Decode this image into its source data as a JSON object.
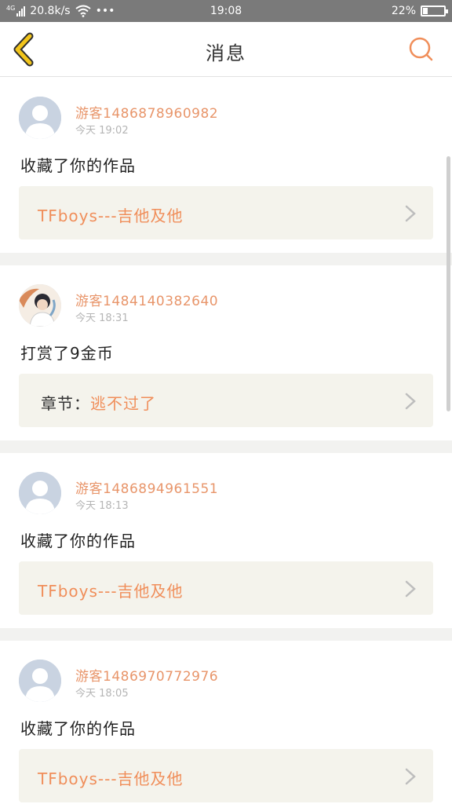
{
  "status_bar": {
    "network_type": "4G",
    "speed": "20.8k/s",
    "dots": "•••",
    "time": "19:08",
    "battery_percent": "22%",
    "battery_level": 0.22
  },
  "header": {
    "title": "消息",
    "back_icon": "chevron-left-icon",
    "search_icon": "search-icon"
  },
  "messages": [
    {
      "username": "游客1486878960982",
      "time": "今天 19:02",
      "action": "收藏了你的作品",
      "ref_label": "",
      "ref_title": "TFboys---吉他及他",
      "avatar": "default"
    },
    {
      "username": "游客1484140382640",
      "time": "今天 18:31",
      "action": "打赏了9金币",
      "ref_label": "章节：",
      "ref_title": "逃不过了",
      "avatar": "photo"
    },
    {
      "username": "游客1486894961551",
      "time": "今天 18:13",
      "action": "收藏了你的作品",
      "ref_label": "",
      "ref_title": "TFboys---吉他及他",
      "avatar": "default"
    },
    {
      "username": "游客1486970772976",
      "time": "今天 18:05",
      "action": "收藏了你的作品",
      "ref_label": "",
      "ref_title": "TFboys---吉他及他",
      "avatar": "default"
    }
  ],
  "colors": {
    "accent": "#f08e5a",
    "back_arrow": "#f2c51c",
    "status_bar": "#7a7a7a"
  }
}
